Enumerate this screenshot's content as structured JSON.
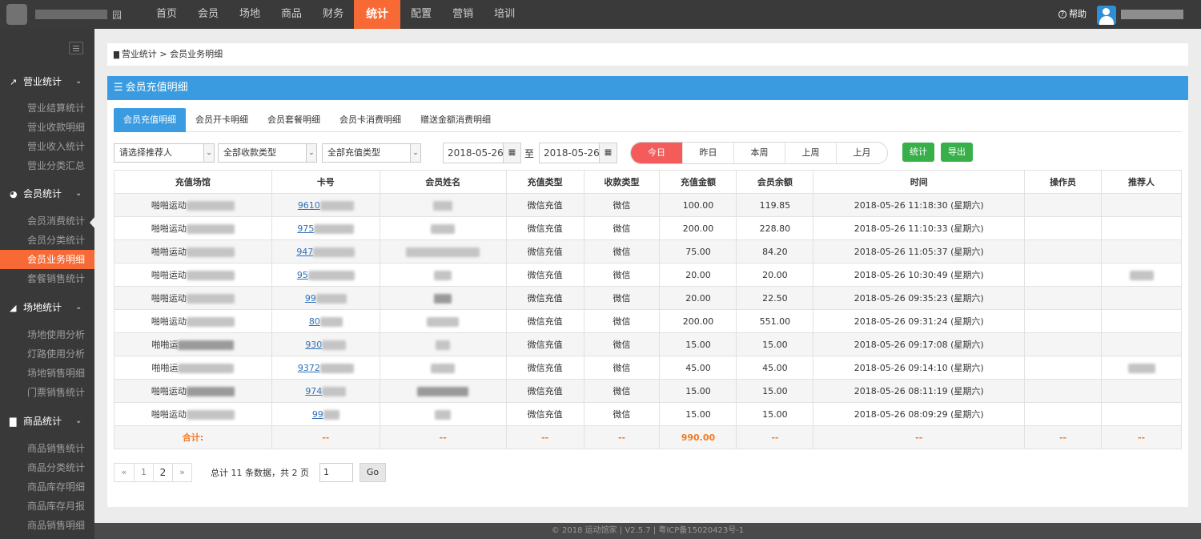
{
  "logo": {
    "suffix": "园"
  },
  "topnav": [
    "首页",
    "会员",
    "场地",
    "商品",
    "财务",
    "统计",
    "配置",
    "营销",
    "培训"
  ],
  "help_label": "帮助",
  "sidebar": [
    {
      "label": "营业统计",
      "icon": "chart-line-icon",
      "items": [
        "营业结算统计",
        "营业收款明细",
        "营业收入统计",
        "营业分类汇总"
      ]
    },
    {
      "label": "会员统计",
      "icon": "pie-chart-icon",
      "items": [
        "会员消费统计",
        "会员分类统计",
        "会员业务明细",
        "套餐销售统计"
      ]
    },
    {
      "label": "场地统计",
      "icon": "area-chart-icon",
      "items": [
        "场地使用分析",
        "灯路使用分析",
        "场地销售明细",
        "门票销售统计"
      ]
    },
    {
      "label": "商品统计",
      "icon": "bar-chart-icon",
      "items": [
        "商品销售统计",
        "商品分类统计",
        "商品库存明细",
        "商品库存月报",
        "商品销售明细"
      ]
    }
  ],
  "breadcrumb": {
    "parent": "营业统计",
    "current": "会员业务明细"
  },
  "panel_title": "会员充值明细",
  "tabs": [
    "会员充值明细",
    "会员开卡明细",
    "会员套餐明细",
    "会员卡消费明细",
    "赠送金额消费明细"
  ],
  "filters": {
    "referrer": "请选择推荐人",
    "pay_type": "全部收款类型",
    "recharge_type": "全部充值类型",
    "date_from": "2018-05-26",
    "date_to": "2018-05-26",
    "to_label": "至",
    "quick": [
      "今日",
      "昨日",
      "本周",
      "上周",
      "上月"
    ],
    "stat_button": "统计",
    "export_button": "导出"
  },
  "table": {
    "headers": [
      "充值场馆",
      "卡号",
      "会员姓名",
      "充值类型",
      "收款类型",
      "充值金额",
      "会员余额",
      "时间",
      "操作员",
      "推荐人"
    ],
    "rows": [
      {
        "venue": "啪啪运动",
        "card": "9610",
        "type": "微信充值",
        "pay": "微信",
        "amount": "100.00",
        "balance": "119.85",
        "time": "2018-05-26 11:18:30 (星期六)"
      },
      {
        "venue": "啪啪运动",
        "card": "975",
        "type": "微信充值",
        "pay": "微信",
        "amount": "200.00",
        "balance": "228.80",
        "time": "2018-05-26 11:10:33 (星期六)"
      },
      {
        "venue": "啪啪运动",
        "card": "947",
        "type": "微信充值",
        "pay": "微信",
        "amount": "75.00",
        "balance": "84.20",
        "time": "2018-05-26 11:05:37 (星期六)"
      },
      {
        "venue": "啪啪运动",
        "card": "95",
        "type": "微信充值",
        "pay": "微信",
        "amount": "20.00",
        "balance": "20.00",
        "time": "2018-05-26 10:30:49 (星期六)"
      },
      {
        "venue": "啪啪运动",
        "card": "99",
        "type": "微信充值",
        "pay": "微信",
        "amount": "20.00",
        "balance": "22.50",
        "time": "2018-05-26 09:35:23 (星期六)"
      },
      {
        "venue": "啪啪运动",
        "card": "80",
        "type": "微信充值",
        "pay": "微信",
        "amount": "200.00",
        "balance": "551.00",
        "time": "2018-05-26 09:31:24 (星期六)"
      },
      {
        "venue": "啪啪运",
        "card": "930",
        "type": "微信充值",
        "pay": "微信",
        "amount": "15.00",
        "balance": "15.00",
        "time": "2018-05-26 09:17:08 (星期六)"
      },
      {
        "venue": "啪啪运",
        "card": "9372",
        "type": "微信充值",
        "pay": "微信",
        "amount": "45.00",
        "balance": "45.00",
        "time": "2018-05-26 09:14:10 (星期六)"
      },
      {
        "venue": "啪啪运动",
        "card": "974",
        "type": "微信充值",
        "pay": "微信",
        "amount": "15.00",
        "balance": "15.00",
        "time": "2018-05-26 08:11:19 (星期六)"
      },
      {
        "venue": "啪啪运动",
        "card": "99",
        "type": "微信充值",
        "pay": "微信",
        "amount": "15.00",
        "balance": "15.00",
        "time": "2018-05-26 08:09:29 (星期六)"
      }
    ],
    "total": {
      "label": "合计:",
      "amount": "990.00",
      "dash": "--"
    }
  },
  "pager": {
    "prev": "«",
    "pages": [
      "1",
      "2"
    ],
    "next": "»",
    "info": "总计 11 条数据，共 2 页",
    "input_value": "1",
    "go": "Go"
  },
  "footer": "© 2018 运动馆家 | V2.5.7 | 粤ICP备15020423号-1",
  "colors": {
    "accent": "#f76a35",
    "primary": "#3a9be0",
    "success": "#38b04a",
    "danger": "#f45b5b",
    "total": "#f47a20"
  }
}
